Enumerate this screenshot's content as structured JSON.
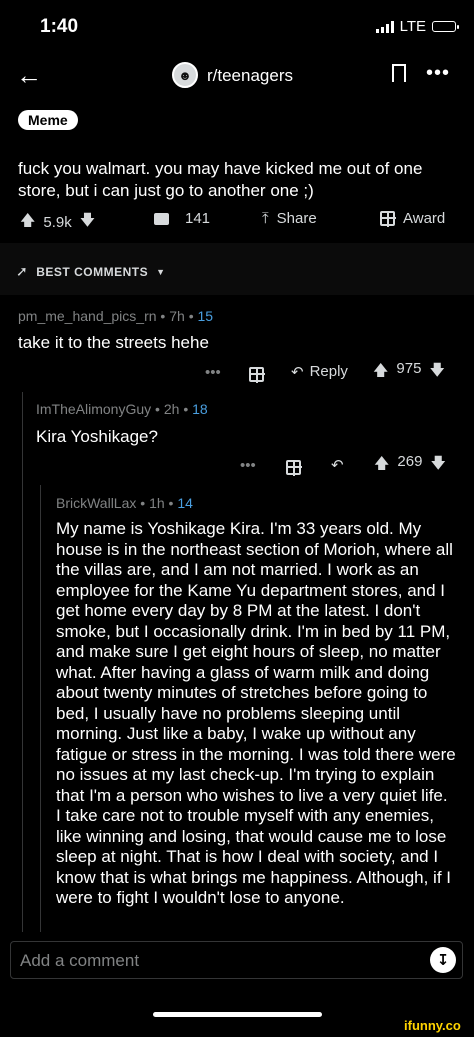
{
  "status_bar": {
    "time": "1:40",
    "network": "LTE"
  },
  "header": {
    "subreddit": "r/teenagers"
  },
  "post": {
    "flair": "Meme",
    "title": "fuck you walmart. you may have kicked me out of one store, but i can just go to another one ;)",
    "upvotes": "5.9k",
    "comments": "141",
    "share_label": "Share",
    "award_label": "Award"
  },
  "sort": {
    "label": "BEST COMMENTS"
  },
  "comments": [
    {
      "author": "pm_me_hand_pics_rn",
      "time": "7h",
      "score": "15",
      "body": "take it to the streets hehe",
      "reply_label": "Reply",
      "votes": "975"
    },
    {
      "author": "ImTheAlimonyGuy",
      "time": "2h",
      "score": "18",
      "body": "Kira Yoshikage?",
      "votes": "269"
    },
    {
      "author": "BrickWallLax",
      "time": "1h",
      "score": "14",
      "body": "My name is Yoshikage Kira. I'm 33 years old. My house is in the northeast section of Morioh, where all the villas are, and I am not married. I work as an employee for the Kame Yu department stores, and I get home every day by 8 PM at the latest. I don't smoke, but I occasionally drink. I'm in bed by 11 PM, and make sure I get eight hours of sleep, no matter what. After having a glass of warm milk and doing about twenty minutes of stretches before going to bed, I usually have no problems sleeping until morning. Just like a baby, I wake up without any fatigue or stress in the morning. I was told there were no issues at my last check-up. I'm trying to explain that I'm a person who wishes to live a very quiet life. I take care not to trouble myself with any enemies, like winning and losing, that would cause me to lose sleep at night. That is how I deal with society, and I know that is what brings me happiness. Although, if I were to fight I wouldn't lose to anyone."
    }
  ],
  "composer": {
    "placeholder": "Add a comment"
  },
  "watermark": "ifunny.co"
}
